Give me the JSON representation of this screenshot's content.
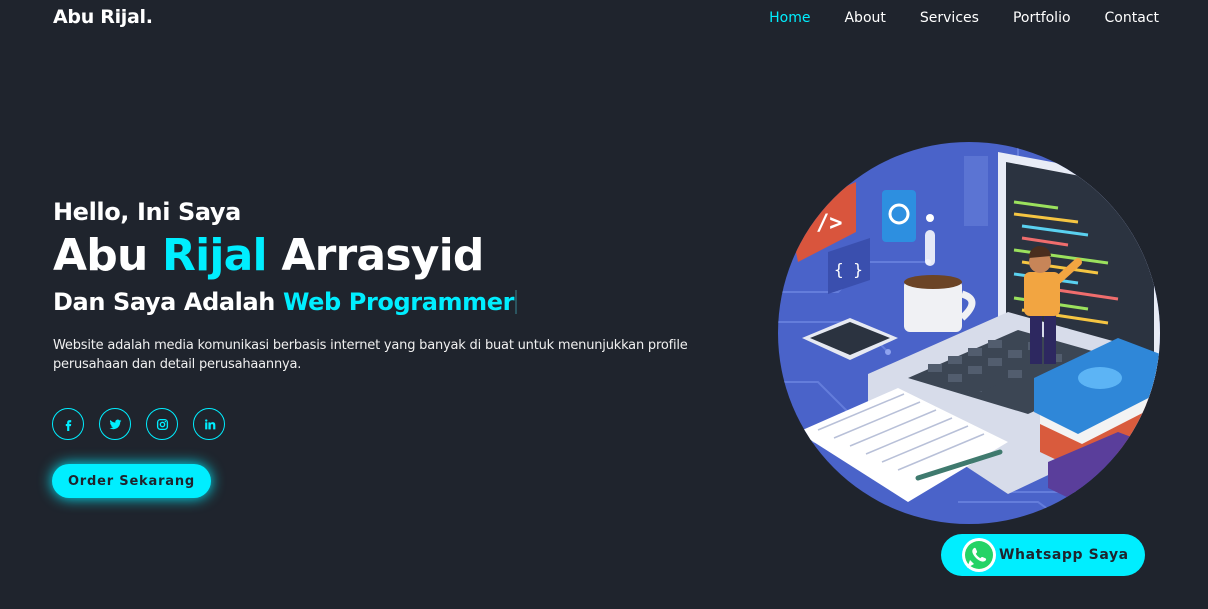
{
  "header": {
    "logo": "Abu Rijal.",
    "nav": [
      {
        "label": "Home",
        "active": true
      },
      {
        "label": "About"
      },
      {
        "label": "Services"
      },
      {
        "label": "Portfolio"
      },
      {
        "label": "Contact"
      }
    ]
  },
  "hero": {
    "greeting": "Hello, Ini Saya",
    "name_first": "Abu",
    "name_highlight": "Rijal",
    "name_last": "Arrasyid",
    "role_prefix": "Dan Saya Adalah",
    "role_highlight": "Web Programmer",
    "description": "Website adalah media komunikasi berbasis internet yang banyak di buat untuk menunjukkan profile perusahaan dan detail perusahaannya.",
    "socials": [
      "facebook-icon",
      "twitter-icon",
      "instagram-icon",
      "linkedin-icon"
    ],
    "cta_label": "Order Sekarang"
  },
  "whatsapp": {
    "label": "Whatsapp Saya",
    "icon": "whatsapp-icon"
  },
  "colors": {
    "background": "#1f242d",
    "accent": "#00eeff",
    "text": "#ffffff"
  }
}
